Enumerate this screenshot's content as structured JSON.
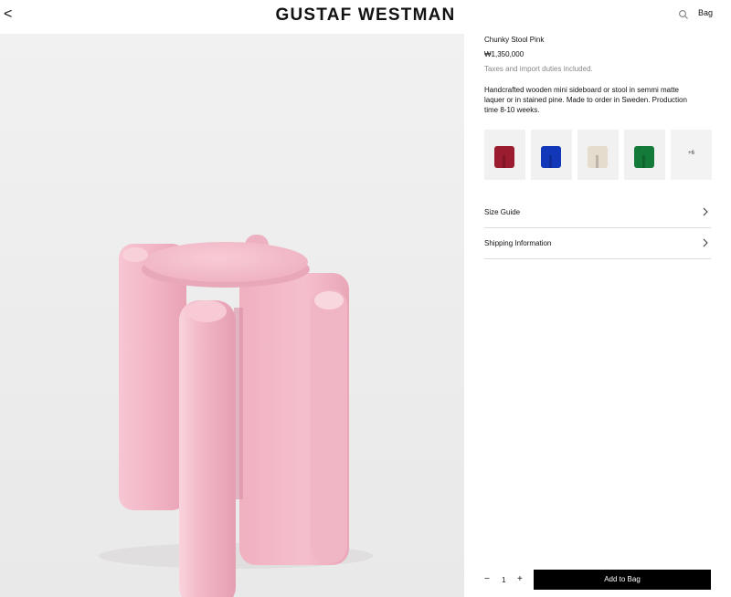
{
  "header": {
    "back_icon": "chevron-left-icon",
    "back_glyph": "<",
    "brand": "GUSTAF WESTMAN",
    "search_icon": "search-icon",
    "bag_label": "Bag"
  },
  "product": {
    "image_alt": "Chunky Stool Pink",
    "title": "Chunky Stool Pink",
    "price": "₩1,350,000",
    "tax_note": "Taxes and import duties included.",
    "description": "Handcrafted wooden mini sideboard or stool in semmi matte laquer or in stained pine. Made to order in Sweden. Production time 8-10 weeks.",
    "colors": {
      "stool_pink": "#f2b6c6",
      "stool_pink_shadow": "#e49cae"
    }
  },
  "swatches": {
    "items": [
      {
        "name": "red",
        "color": "#9b1c2e"
      },
      {
        "name": "blue",
        "color": "#1237b8"
      },
      {
        "name": "cream",
        "color": "#e6dccd"
      },
      {
        "name": "green",
        "color": "#137a3a"
      }
    ],
    "more_label": "+6"
  },
  "accordions": {
    "size_guide": "Size Guide",
    "shipping": "Shipping Information",
    "chevron_icon": "chevron-right-icon"
  },
  "cart": {
    "minus": "−",
    "quantity": "1",
    "plus": "+",
    "add_label": "Add to Bag"
  }
}
